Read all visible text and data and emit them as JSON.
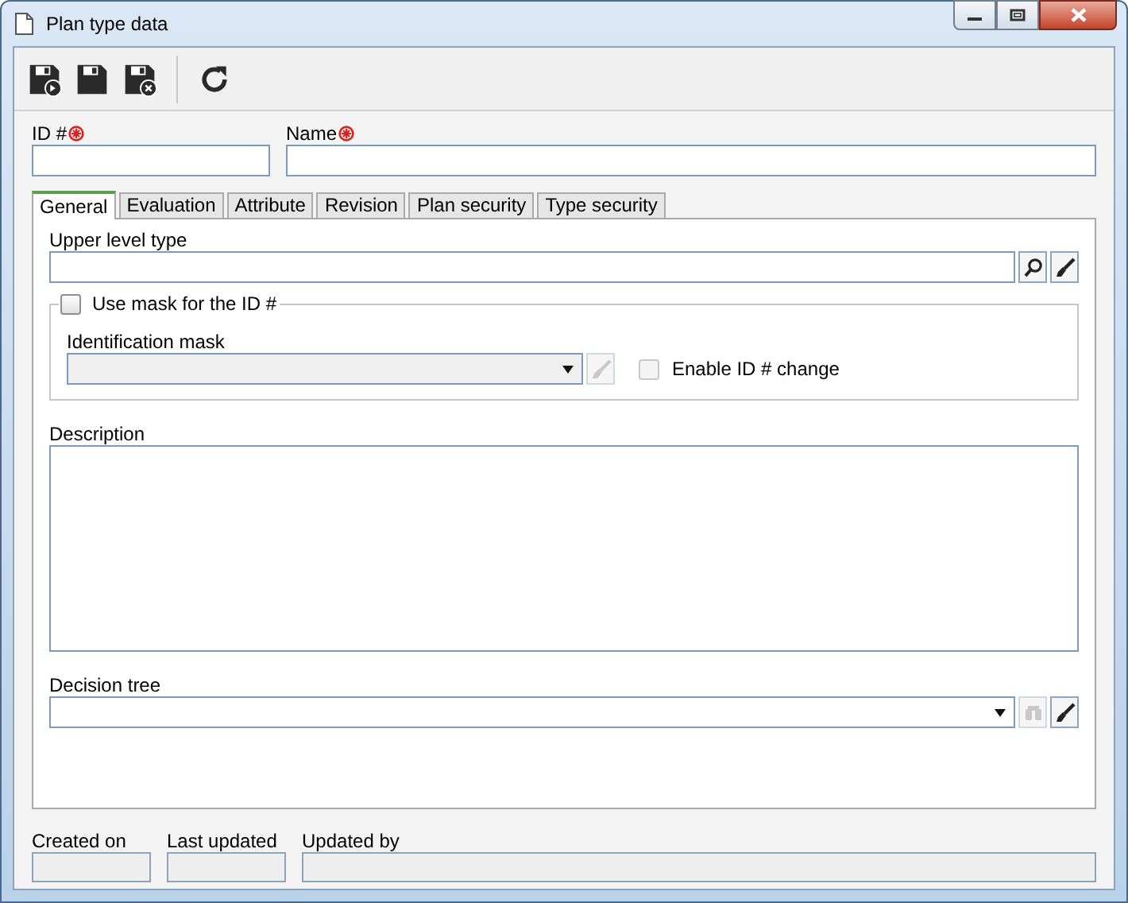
{
  "window": {
    "title": "Plan type data"
  },
  "toolbar": [
    {
      "kind": "save-new"
    },
    {
      "kind": "save"
    },
    {
      "kind": "save-close"
    },
    {
      "kind": "separator"
    },
    {
      "kind": "refresh"
    }
  ],
  "fields": [
    {
      "label": "ID #",
      "required": true
    },
    {
      "label": "Name",
      "required": true
    }
  ],
  "tabs": [
    {
      "label": "General",
      "selected": true
    },
    {
      "label": "Evaluation",
      "selected": false
    },
    {
      "label": "Attribute",
      "selected": false
    },
    {
      "label": "Revision",
      "selected": false
    },
    {
      "label": "Plan security",
      "selected": false
    },
    {
      "label": "Type security",
      "selected": false
    }
  ],
  "general": {
    "upper_level_type": {
      "label": "Upper level type"
    },
    "mask_group": {
      "label": "Use mask for the ID #",
      "checked": false,
      "identification_mask": {
        "label": "Identification mask",
        "disabled": true
      },
      "enable_id_change": {
        "label": "Enable ID # change",
        "checked": false,
        "disabled": true
      }
    },
    "description": {
      "label": "Description"
    },
    "decision_tree": {
      "label": "Decision tree",
      "view_disabled": true
    }
  },
  "footer": [
    {
      "label": "Created on"
    },
    {
      "label": "Last updated"
    },
    {
      "label": "Updated by"
    }
  ]
}
